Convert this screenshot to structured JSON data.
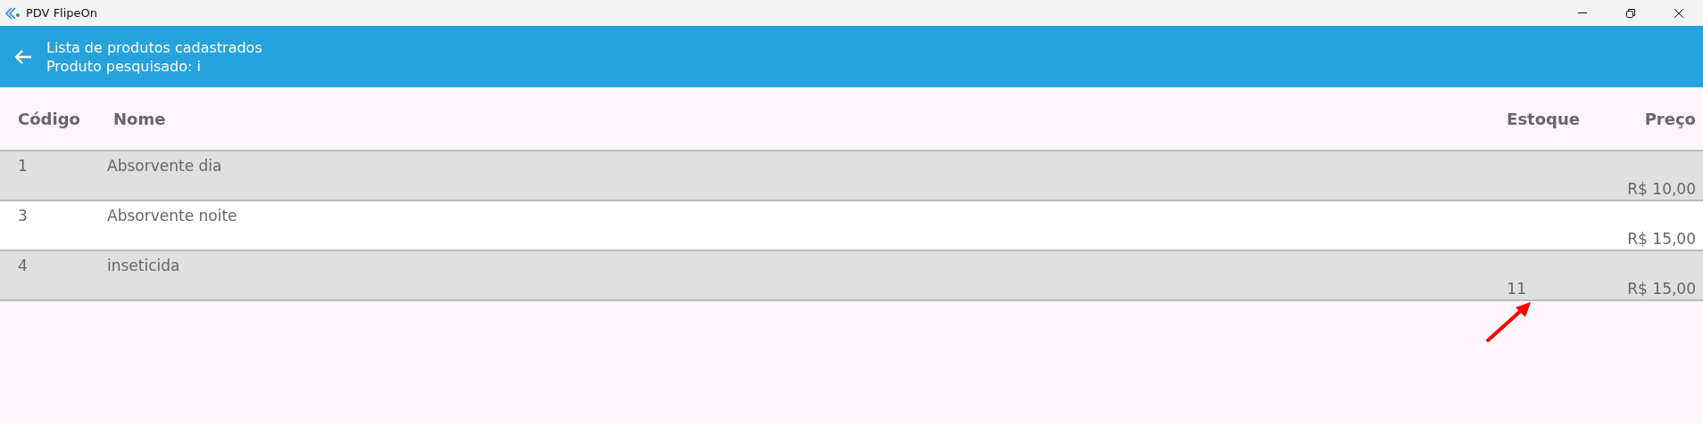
{
  "window": {
    "title": "PDV FlipeOn"
  },
  "header": {
    "title": "Lista de produtos cadastrados",
    "subtitle": "Produto pesquisado: i"
  },
  "table": {
    "columns": [
      "Código",
      "Nome",
      "Estoque",
      "Preço"
    ],
    "rows": [
      {
        "code": "1",
        "name": "Absorvente dia",
        "stock": "",
        "price": "R$ 10,00"
      },
      {
        "code": "3",
        "name": "Absorvente noite",
        "stock": "",
        "price": "R$ 15,00"
      },
      {
        "code": "4",
        "name": "inseticida",
        "stock": "11",
        "price": "R$ 15,00"
      }
    ]
  }
}
